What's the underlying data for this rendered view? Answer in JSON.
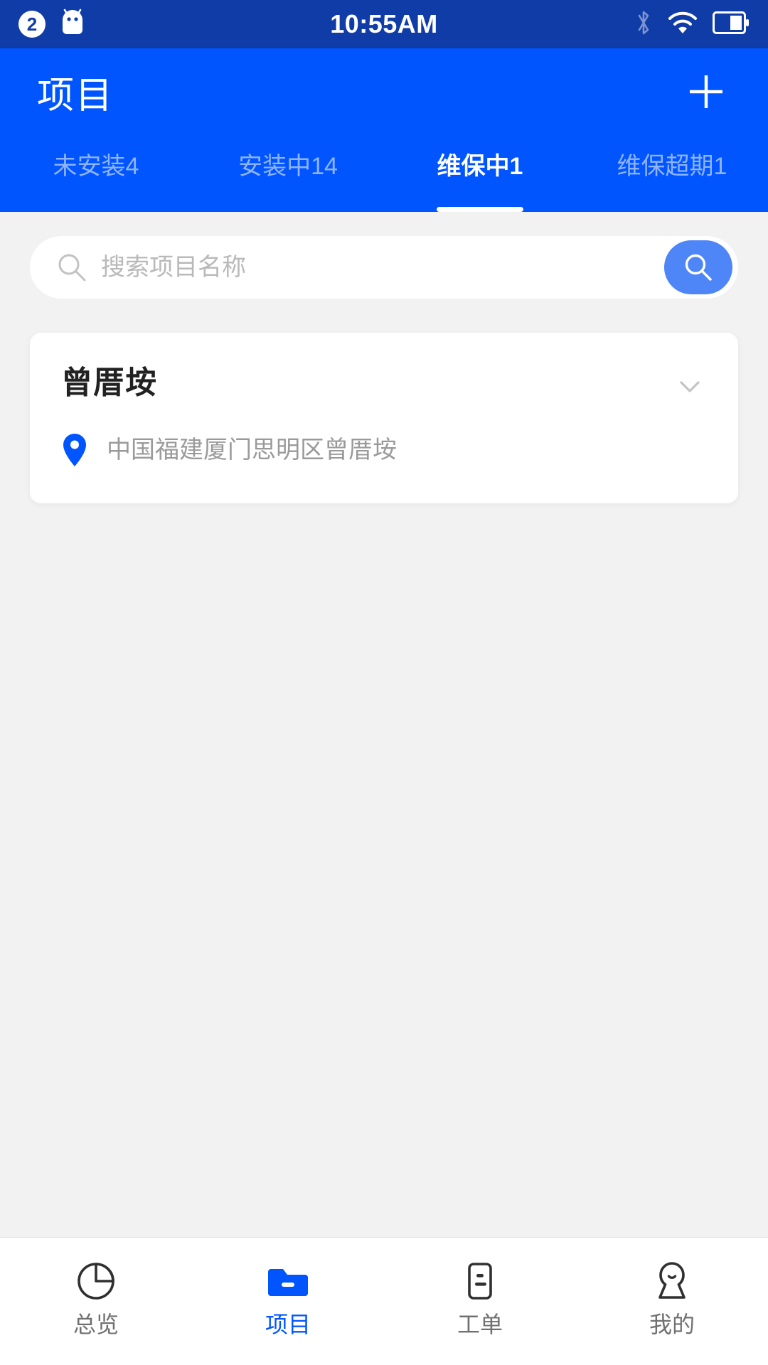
{
  "colors": {
    "status_bar_bg": "#103CA8",
    "header_bg": "#0055FF",
    "accent": "#0055FF",
    "search_button": "#4E86F7",
    "tab_inactive": "#8FB4FF",
    "page_bg": "#f2f2f2",
    "card_bg": "#ffffff",
    "muted_text": "#9a9a9a"
  },
  "status_bar": {
    "notification_count": "2",
    "android_icon": "android-robot-icon",
    "time": "10:55AM",
    "icons": [
      "bluetooth-icon",
      "wifi-icon",
      "battery-icon"
    ]
  },
  "header": {
    "title": "项目",
    "add_icon": "plus-icon",
    "tabs": [
      {
        "label": "未安装4",
        "name": "tab-not-installed",
        "active": false
      },
      {
        "label": "安装中14",
        "name": "tab-installing",
        "active": false
      },
      {
        "label": "维保中1",
        "name": "tab-maintenance",
        "active": true
      },
      {
        "label": "维保超期1",
        "name": "tab-maintenance-overdue",
        "active": false
      }
    ]
  },
  "search": {
    "placeholder": "搜索项目名称",
    "value": "",
    "input_icon": "search-icon",
    "button_icon": "search-icon"
  },
  "projects": [
    {
      "title": "曾厝垵",
      "address": "中国福建厦门思明区曾厝垵",
      "pin_icon": "location-pin-icon",
      "expand_icon": "chevron-down-icon"
    }
  ],
  "bottom_nav": [
    {
      "label": "总览",
      "icon": "pie-chart-icon",
      "name": "nav-overview",
      "active": false
    },
    {
      "label": "项目",
      "icon": "folder-icon",
      "name": "nav-projects",
      "active": true
    },
    {
      "label": "工单",
      "icon": "work-order-icon",
      "name": "nav-work-orders",
      "active": false
    },
    {
      "label": "我的",
      "icon": "person-icon",
      "name": "nav-profile",
      "active": false
    }
  ]
}
